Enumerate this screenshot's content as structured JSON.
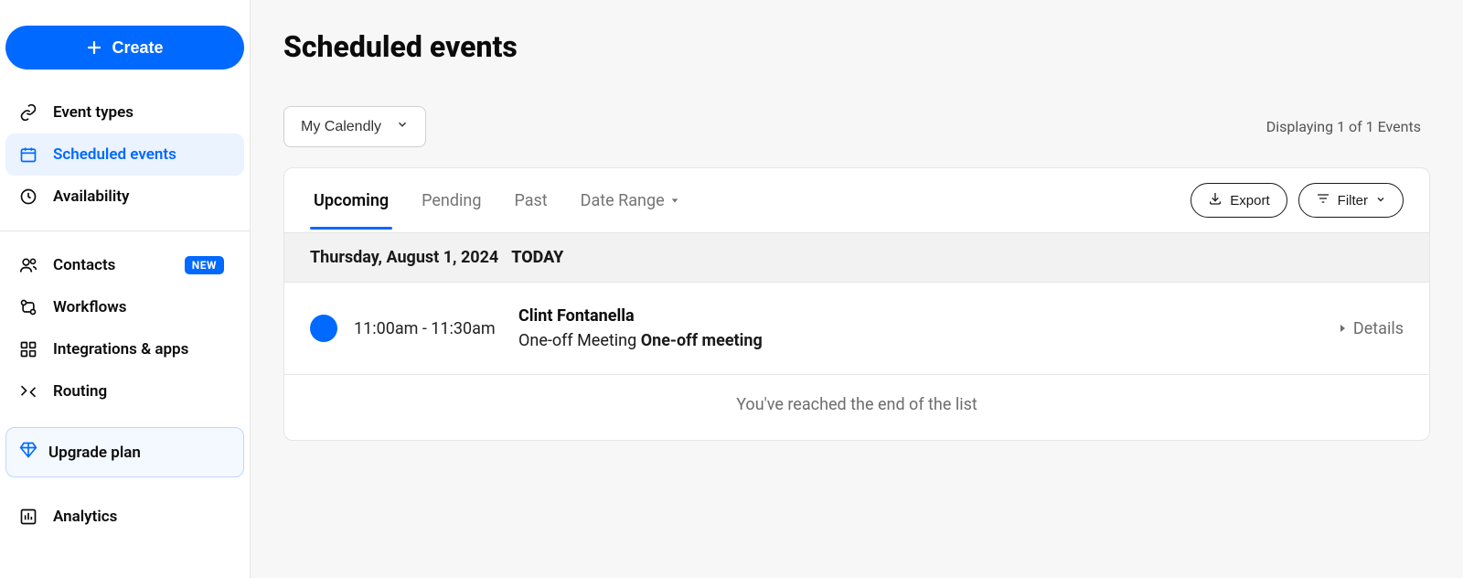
{
  "sidebar": {
    "create_label": "Create",
    "items_top": [
      {
        "label": "Event types",
        "icon": "link-icon"
      },
      {
        "label": "Scheduled events",
        "icon": "calendar-icon"
      },
      {
        "label": "Availability",
        "icon": "clock-icon"
      }
    ],
    "items_bottom": [
      {
        "label": "Contacts",
        "icon": "contacts-icon",
        "badge": "NEW"
      },
      {
        "label": "Workflows",
        "icon": "workflows-icon"
      },
      {
        "label": "Integrations & apps",
        "icon": "apps-icon"
      },
      {
        "label": "Routing",
        "icon": "routing-icon"
      }
    ],
    "upgrade_label": "Upgrade plan",
    "analytics_label": "Analytics"
  },
  "main": {
    "title": "Scheduled events",
    "calendar_selector": "My Calendly",
    "count_text": "Displaying 1 of 1 Events",
    "tabs": [
      {
        "label": "Upcoming"
      },
      {
        "label": "Pending"
      },
      {
        "label": "Past"
      },
      {
        "label": "Date Range"
      }
    ],
    "export_label": "Export",
    "filter_label": "Filter",
    "date_header": {
      "date": "Thursday, August 1, 2024",
      "badge": "TODAY"
    },
    "event": {
      "time": "11:00am - 11:30am",
      "attendee": "Clint Fontanella",
      "type_label": "One-off Meeting ",
      "type_name": "One-off meeting",
      "details_label": "Details"
    },
    "end_of_list": "You've reached the end of the list"
  }
}
